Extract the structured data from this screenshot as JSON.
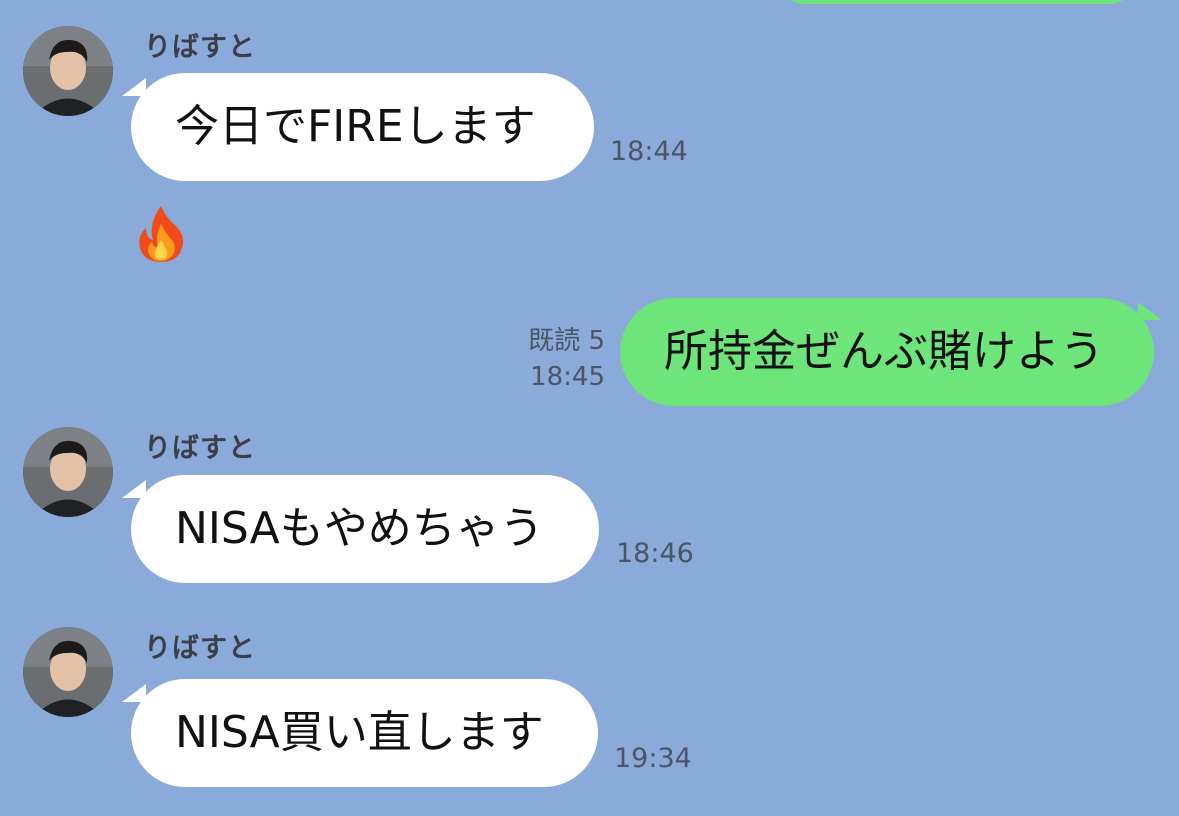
{
  "chat": {
    "messages": [
      {
        "sender": "りばすと",
        "text": "今日でFIREします",
        "time": "18:44"
      },
      {
        "sender": "",
        "emoji": "fire-emoji"
      },
      {
        "direction": "out",
        "text": "所持金ぜんぶ賭けよう",
        "read_label": "既読 5",
        "time": "18:45"
      },
      {
        "sender": "りばすと",
        "text": "NISAもやめちゃう",
        "time": "18:46"
      },
      {
        "sender": "りばすと",
        "text": "NISA買い直します",
        "time": "19:34"
      }
    ]
  },
  "colors": {
    "background": "#8aabd9",
    "incoming_bubble": "#ffffff",
    "outgoing_bubble": "#6de57a",
    "meta_text": "#4a5566"
  }
}
